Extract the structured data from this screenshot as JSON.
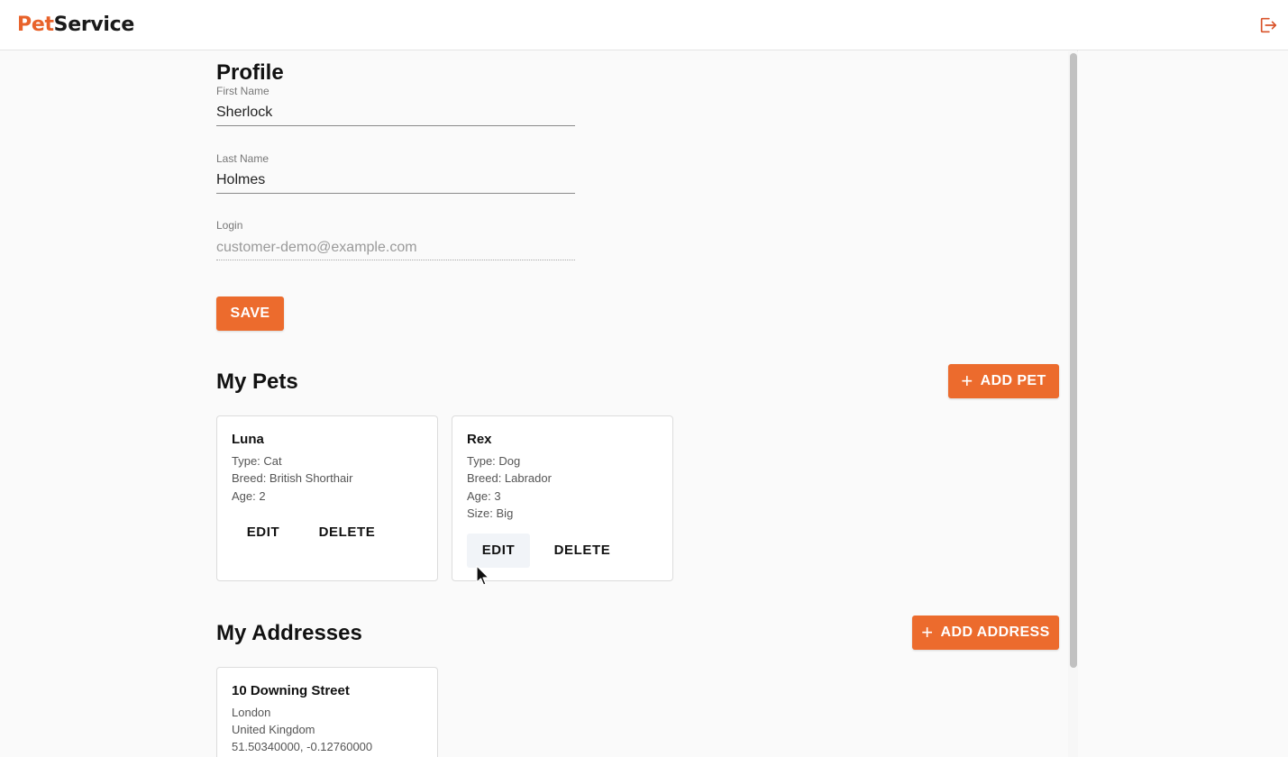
{
  "app": {
    "logo_part1": "Pet",
    "logo_part2": "Service",
    "logout_icon": "logout-icon"
  },
  "profile": {
    "title": "Profile",
    "first_name": {
      "label": "First Name",
      "value": "Sherlock"
    },
    "last_name": {
      "label": "Last Name",
      "value": "Holmes"
    },
    "login": {
      "label": "Login",
      "value": "customer-demo@example.com"
    },
    "save_label": "SAVE"
  },
  "pets": {
    "title": "My Pets",
    "add_label": "ADD PET",
    "items": [
      {
        "name": "Luna",
        "lines": [
          "Type: Cat",
          "Breed: British Shorthair",
          "Age: 2"
        ],
        "edit_label": "EDIT",
        "delete_label": "DELETE"
      },
      {
        "name": "Rex",
        "lines": [
          "Type: Dog",
          "Breed: Labrador",
          "Age: 3",
          "Size: Big"
        ],
        "edit_label": "EDIT",
        "delete_label": "DELETE"
      }
    ]
  },
  "addresses": {
    "title": "My Addresses",
    "add_label": "ADD ADDRESS",
    "items": [
      {
        "name": "10 Downing Street",
        "lines": [
          "London",
          "United Kingdom",
          "51.50340000, -0.12760000"
        ]
      }
    ]
  },
  "colors": {
    "accent": "#ec6b2d",
    "logo_pet": "#e8622a"
  }
}
